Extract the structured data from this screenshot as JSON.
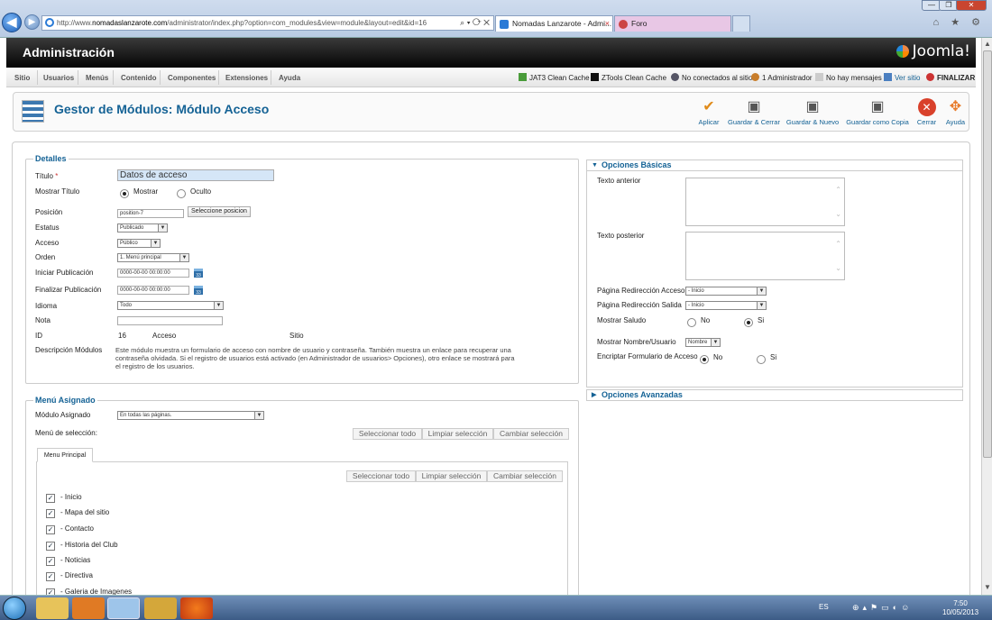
{
  "browser": {
    "url_prefix": "http://www.",
    "url_domain": "nomadaslanzarote.com",
    "url_rest": "/administrator/index.php?option=com_modules&view=module&layout=edit&id=16",
    "tab_active": "Nomadas Lanzarote - Admi...",
    "tab_other": "Foro",
    "tab_close": "×",
    "back": "◀",
    "forward": "▶",
    "addr_tools": "⌕ ▾ ⟳ ✕",
    "nav_icons": "⌂ ★ ⚙",
    "win_min": "—",
    "win_max": "❐",
    "win_close": "✕"
  },
  "header": {
    "title": "Administración",
    "logo": "Joomla!"
  },
  "menu": {
    "items": [
      "Sitio",
      "Usuarios",
      "Menús",
      "Contenido",
      "Componentes",
      "Extensiones",
      "Ayuda"
    ]
  },
  "status": {
    "jat3": "JAT3 Clean Cache",
    "ztools": "ZTools Clean Cache",
    "not_connected": "No conectados al sitio",
    "admin": "1 Administrador",
    "messages": "No hay mensajes",
    "view_site": "Ver sitio",
    "logout": "FINALIZAR"
  },
  "toolbar": {
    "title": "Gestor de Módulos: Módulo Acceso",
    "apply": "Aplicar",
    "save_close": "Guardar & Cerrar",
    "save_new": "Guardar & Nuevo",
    "save_copy": "Guardar como Copia",
    "close": "Cerrar",
    "help": "Ayuda"
  },
  "details": {
    "legend": "Detalles",
    "title_label": "Título",
    "required_mark": "*",
    "title_value": "Datos de acceso",
    "show_title_label": "Mostrar Título",
    "show": "Mostrar",
    "hide": "Oculto",
    "position_label": "Posición",
    "position_value": "position-7",
    "select_position": "Seleccione posicion",
    "status_label": "Estatus",
    "status_value": "Publicado",
    "access_label": "Acceso",
    "access_value": "Público",
    "order_label": "Orden",
    "order_value": "1. Menú principal",
    "start_label": "Iniciar Publicación",
    "start_value": "0000-00-00 00:00:00",
    "finish_label": "Finalizar Publicación",
    "finish_value": "0000-00-00 00:00:00",
    "cal_text": "33",
    "language_label": "Idioma",
    "language_value": "Todo",
    "note_label": "Nota",
    "note_value": "",
    "id_label": "ID",
    "id_value": "16",
    "module_name": "Acceso",
    "client": "Sitio",
    "desc_label": "Descripción Módulos",
    "desc_line1": "Este módulo muestra un formulario de acceso con nombre de usuario y contraseña. También muestra un enlace para recuperar una",
    "desc_line2": "contraseña olvidada. Si el registro de usuarios está activado (en Administrador de usuarios> Opciones), otro enlace se mostrará para",
    "desc_line3": "el registro de los usuarios."
  },
  "assignment": {
    "legend": "Menú Asignado",
    "module_assign_label": "Módulo Asignado",
    "module_assign_value": "En todas las páginas.",
    "menu_select_label": "Menú de selección:",
    "select_all": "Seleccionar todo",
    "clear_selection": "Limpiar selección",
    "toggle_selection": "Cambiar selección",
    "tab": "Menu Principal",
    "items": [
      "- Inicio",
      "- Mapa del sitio",
      "- Contacto",
      "- Historia del Club",
      "- Noticias",
      "- Directiva",
      "- Galeria de Imagenes"
    ],
    "check": "✓"
  },
  "basic": {
    "header": "Opciones Básicas",
    "arrow_open": "▼",
    "pre_text_label": "Texto anterior",
    "post_text_label": "Texto posterior",
    "login_redirect_label": "Página Redirección Acceso",
    "login_redirect_value": "- Inicio",
    "logout_redirect_label": "Página Redirección Salida",
    "logout_redirect_value": "- Inicio",
    "greeting_label": "Mostrar Saludo",
    "no": "No",
    "yes": "Si",
    "name_label": "Mostrar Nombre/Usuario",
    "name_value": "Nombre",
    "encrypt_label": "Encriptar Formulario de Acceso"
  },
  "advanced": {
    "header": "Opciones Avanzadas",
    "arrow_closed": "▶"
  },
  "dd_arrow": "▼",
  "taskbar": {
    "lang": "ES",
    "time": "7:50",
    "date": "10/05/2013"
  },
  "colors": {
    "accent": "#146295",
    "header_bg": "#000000"
  }
}
